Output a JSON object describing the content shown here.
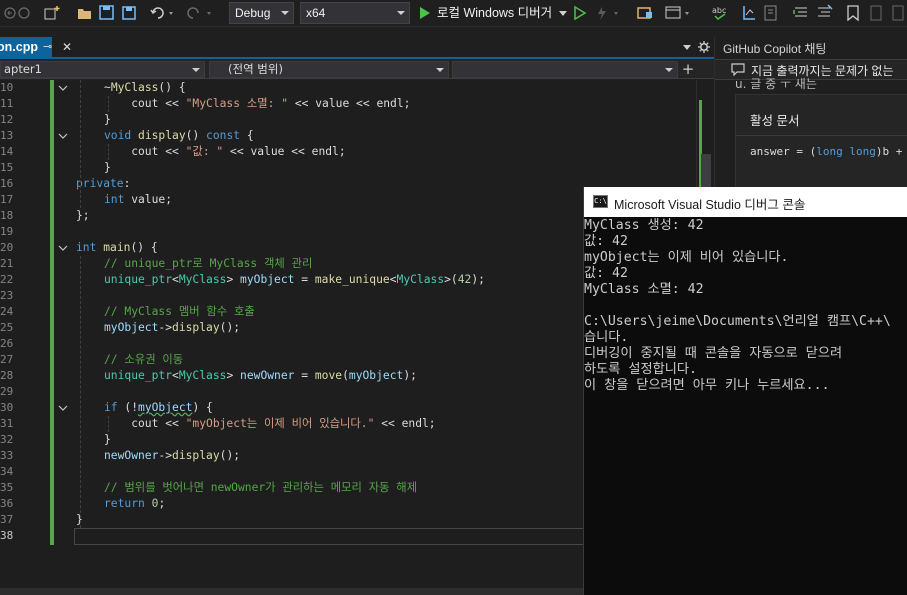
{
  "toolbar": {
    "config": "Debug",
    "platform": "x64",
    "run_label": "로컬 Windows 디버거"
  },
  "editor": {
    "tab_label": "on.cpp",
    "tab_pin": "⊸",
    "tab_close": "✕",
    "nav_scope": "apter1",
    "nav_member": "(전역 범위)",
    "nav_add": "+",
    "lines": [
      {
        "n": "10",
        "tokens": [
          [
            "pl",
            "~"
          ],
          [
            "fn",
            "MyClass"
          ],
          [
            "pl",
            "() {"
          ]
        ]
      },
      {
        "n": "11",
        "tokens": [
          [
            "pl",
            "    cout << "
          ],
          [
            "st",
            "\"MyClass 소멸: \""
          ],
          [
            "pl",
            " << value << endl;"
          ]
        ]
      },
      {
        "n": "12",
        "tokens": [
          [
            "pl",
            "}"
          ]
        ]
      },
      {
        "n": "13",
        "tokens": [
          [
            "kw",
            "void"
          ],
          [
            "pl",
            " "
          ],
          [
            "fn",
            "display"
          ],
          [
            "pl",
            "() "
          ],
          [
            "kw",
            "const"
          ],
          [
            "pl",
            " {"
          ]
        ]
      },
      {
        "n": "14",
        "tokens": [
          [
            "pl",
            "    cout << "
          ],
          [
            "st",
            "\"값: \""
          ],
          [
            "pl",
            " << value << endl;"
          ]
        ]
      },
      {
        "n": "15",
        "tokens": [
          [
            "pl",
            "}"
          ]
        ]
      },
      {
        "n": "16",
        "tokens": [
          [
            "kw",
            "private"
          ],
          [
            "pl",
            ":"
          ]
        ]
      },
      {
        "n": "17",
        "tokens": [
          [
            "kw",
            "int"
          ],
          [
            "pl",
            " value;"
          ]
        ]
      },
      {
        "n": "18",
        "tokens": [
          [
            "pl",
            "};"
          ]
        ]
      },
      {
        "n": "19",
        "tokens": []
      },
      {
        "n": "20",
        "tokens": [
          [
            "kw",
            "int"
          ],
          [
            "pl",
            " "
          ],
          [
            "fn",
            "main"
          ],
          [
            "pl",
            "() {"
          ]
        ]
      },
      {
        "n": "21",
        "tokens": [
          [
            "cm",
            "// unique_ptr로 MyClass 객체 관리"
          ]
        ]
      },
      {
        "n": "22",
        "tokens": [
          [
            "ty",
            "unique_ptr"
          ],
          [
            "pl",
            "<"
          ],
          [
            "ty",
            "MyClass"
          ],
          [
            "pl",
            "> "
          ],
          [
            "va",
            "myObject"
          ],
          [
            "pl",
            " = "
          ],
          [
            "fn",
            "make_unique"
          ],
          [
            "pl",
            "<"
          ],
          [
            "ty",
            "MyClass"
          ],
          [
            "pl",
            ">("
          ],
          [
            "nu",
            "42"
          ],
          [
            "pl",
            ");"
          ]
        ]
      },
      {
        "n": "23",
        "tokens": []
      },
      {
        "n": "24",
        "tokens": [
          [
            "cm",
            "// MyClass 멤버 함수 호출"
          ]
        ]
      },
      {
        "n": "25",
        "tokens": [
          [
            "va",
            "myObject"
          ],
          [
            "pl",
            "->"
          ],
          [
            "fn",
            "display"
          ],
          [
            "pl",
            "();"
          ]
        ]
      },
      {
        "n": "26",
        "tokens": []
      },
      {
        "n": "27",
        "tokens": [
          [
            "cm",
            "// 소유권 이동"
          ]
        ]
      },
      {
        "n": "28",
        "tokens": [
          [
            "ty",
            "unique_ptr"
          ],
          [
            "pl",
            "<"
          ],
          [
            "ty",
            "MyClass"
          ],
          [
            "pl",
            "> "
          ],
          [
            "va",
            "newOwner"
          ],
          [
            "pl",
            " = "
          ],
          [
            "fn",
            "move"
          ],
          [
            "pl",
            "("
          ],
          [
            "va",
            "myObject"
          ],
          [
            "pl",
            ");"
          ]
        ]
      },
      {
        "n": "29",
        "tokens": []
      },
      {
        "n": "30",
        "tokens": [
          [
            "kw",
            "if"
          ],
          [
            "pl",
            " (!"
          ],
          [
            "sq",
            "myObject"
          ],
          [
            "pl",
            ") {"
          ]
        ]
      },
      {
        "n": "31",
        "tokens": [
          [
            "pl",
            "    cout << "
          ],
          [
            "st",
            "\"myObject는 이제 비어 있습니다.\""
          ],
          [
            "pl",
            " << endl;"
          ]
        ]
      },
      {
        "n": "32",
        "tokens": [
          [
            "pl",
            "}"
          ]
        ]
      },
      {
        "n": "33",
        "tokens": [
          [
            "va",
            "newOwner"
          ],
          [
            "pl",
            "->"
          ],
          [
            "fn",
            "display"
          ],
          [
            "pl",
            "();"
          ]
        ]
      },
      {
        "n": "34",
        "tokens": []
      },
      {
        "n": "35",
        "tokens": [
          [
            "cm",
            "// 범위를 벗어나면 newOwner가 관리하는 메모리 자동 해제"
          ]
        ]
      },
      {
        "n": "36",
        "tokens": [
          [
            "kw",
            "return"
          ],
          [
            "pl",
            " "
          ],
          [
            "nu",
            "0"
          ],
          [
            "pl",
            ";"
          ]
        ]
      },
      {
        "n": "37",
        "tokens": [
          [
            "pl",
            "}"
          ]
        ]
      },
      {
        "n": "38",
        "tokens": []
      }
    ]
  },
  "copilot": {
    "title": "GitHub Copilot 채팅",
    "banner": "지금 출력까지는 문제가 없는",
    "partial_text": "u. 글 중 ㅜ 새는",
    "active_doc_title": "활성 문서",
    "active_doc_code": [
      [
        "pl",
        "answer = ("
      ],
      [
        "kw",
        "long long"
      ],
      [
        "pl",
        ")b +"
      ]
    ]
  },
  "console": {
    "title": "Microsoft Visual Studio 디버그 콘솔",
    "icon_text": "C:\\",
    "lines": [
      "MyClass 생성: 42",
      "값: 42",
      "myObject는 이제 비어 있습니다.",
      "값: 42",
      "MyClass 소멸: 42",
      "",
      "C:\\Users\\jeime\\Documents\\언리얼 캠프\\C++\\",
      "습니다.",
      "디버깅이 중지될 때 콘솔을 자동으로 닫으려",
      "하도록 설정합니다.",
      "이 창을 닫으려면 아무 키나 누르세요..."
    ]
  },
  "colors": {
    "accent": "#0e639c",
    "change_bar": "#57a64a",
    "keyword": "#569cd6",
    "type": "#4ec9b0",
    "function": "#dcdcaa",
    "string": "#d69d85",
    "comment": "#57a64a"
  }
}
